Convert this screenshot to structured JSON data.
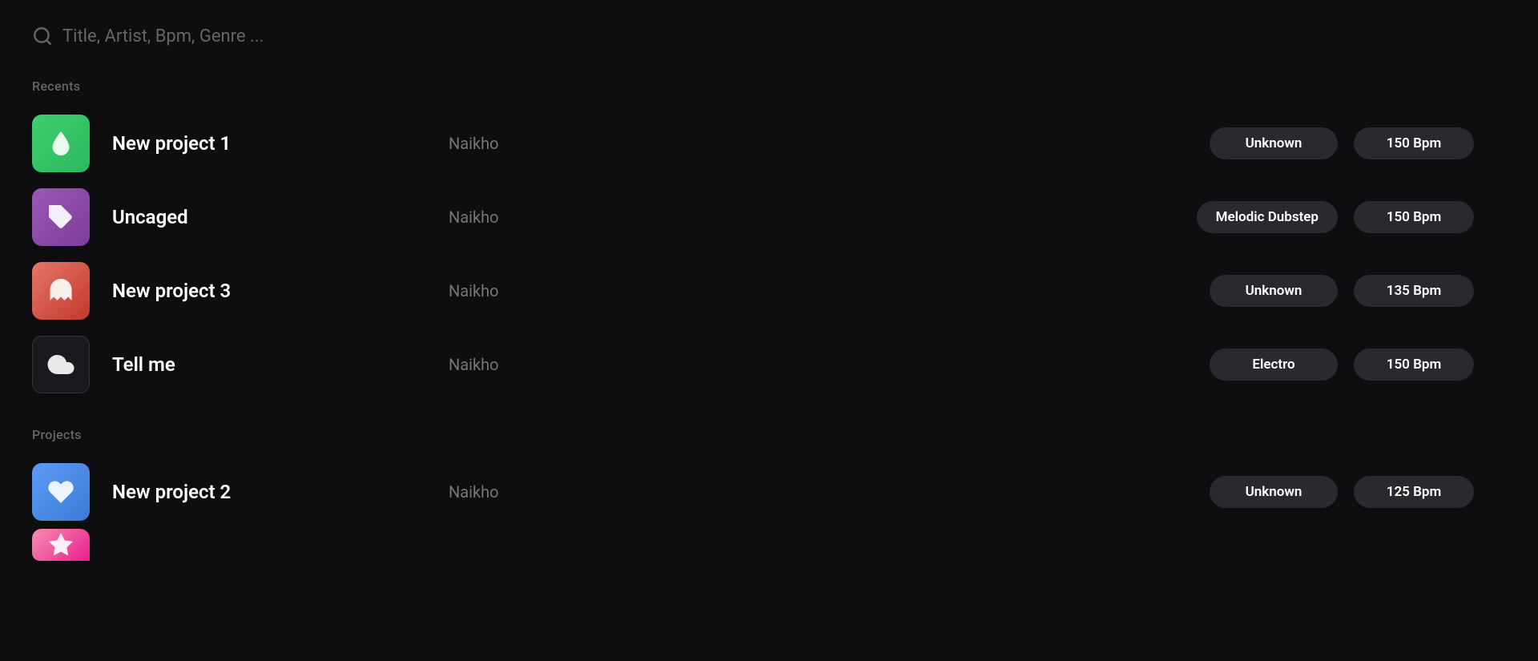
{
  "search": {
    "placeholder": "Title, Artist, Bpm, Genre ..."
  },
  "sections": [
    {
      "id": "recents",
      "label": "Recents",
      "tracks": [
        {
          "id": "new-project-1",
          "title": "New project 1",
          "artist": "Naikho",
          "genre": "Unknown",
          "bpm": "150 Bpm",
          "thumbClass": "thumb-green",
          "thumbIcon": "drop"
        },
        {
          "id": "uncaged",
          "title": "Uncaged",
          "artist": "Naikho",
          "genre": "Melodic Dubstep",
          "bpm": "150 Bpm",
          "thumbClass": "thumb-purple",
          "thumbIcon": "tag"
        },
        {
          "id": "new-project-3",
          "title": "New project 3",
          "artist": "Naikho",
          "genre": "Unknown",
          "bpm": "135 Bpm",
          "thumbClass": "thumb-salmon",
          "thumbIcon": "ghost"
        },
        {
          "id": "tell-me",
          "title": "Tell me",
          "artist": "Naikho",
          "genre": "Electro",
          "bpm": "150 Bpm",
          "thumbClass": "thumb-black",
          "thumbIcon": "cloud"
        }
      ]
    },
    {
      "id": "projects",
      "label": "Projects",
      "tracks": [
        {
          "id": "new-project-2",
          "title": "New project 2",
          "artist": "Naikho",
          "genre": "Unknown",
          "bpm": "125 Bpm",
          "thumbClass": "thumb-blue",
          "thumbIcon": "heart"
        },
        {
          "id": "partial-project",
          "title": "",
          "artist": "",
          "genre": "",
          "bpm": "",
          "thumbClass": "thumb-pink",
          "thumbIcon": "star"
        }
      ]
    }
  ]
}
